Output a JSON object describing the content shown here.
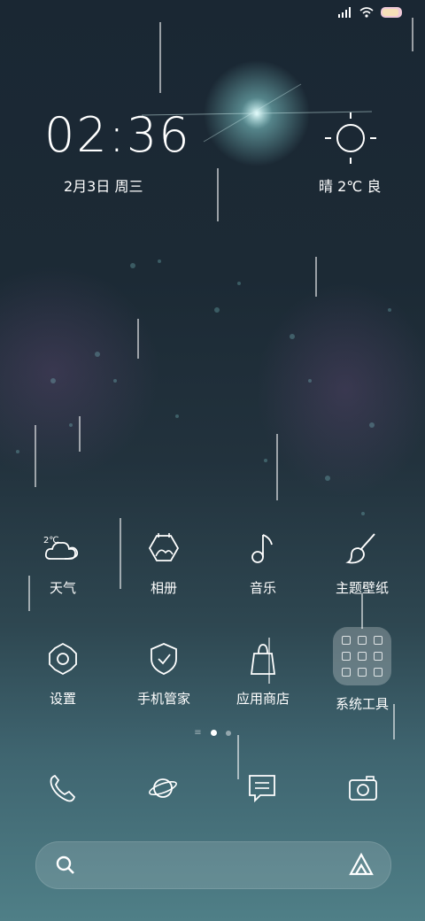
{
  "lockscreen": {
    "time": "02:36",
    "date": "2月3日 周三",
    "weather": "晴 2℃ 良"
  },
  "apps": [
    {
      "name": "weather",
      "label": "天气",
      "icon": "cloud-weather-icon",
      "badge": "2℃"
    },
    {
      "name": "gallery",
      "label": "相册",
      "icon": "gallery-icon"
    },
    {
      "name": "music",
      "label": "音乐",
      "icon": "music-note-icon"
    },
    {
      "name": "themes",
      "label": "主题壁纸",
      "icon": "paintbrush-icon"
    },
    {
      "name": "settings",
      "label": "设置",
      "icon": "gear-icon"
    },
    {
      "name": "security",
      "label": "手机管家",
      "icon": "shield-check-icon"
    },
    {
      "name": "appstore",
      "label": "应用商店",
      "icon": "shopping-bag-icon"
    },
    {
      "name": "tools",
      "label": "系统工具",
      "icon": "folder-icon"
    }
  ],
  "dock": [
    "phone-icon",
    "browser-planet-icon",
    "messages-icon",
    "camera-icon"
  ],
  "search": {
    "placeholder": ""
  },
  "colors": {
    "background_top": "#1a2733",
    "background_bottom": "#4f7f87"
  }
}
